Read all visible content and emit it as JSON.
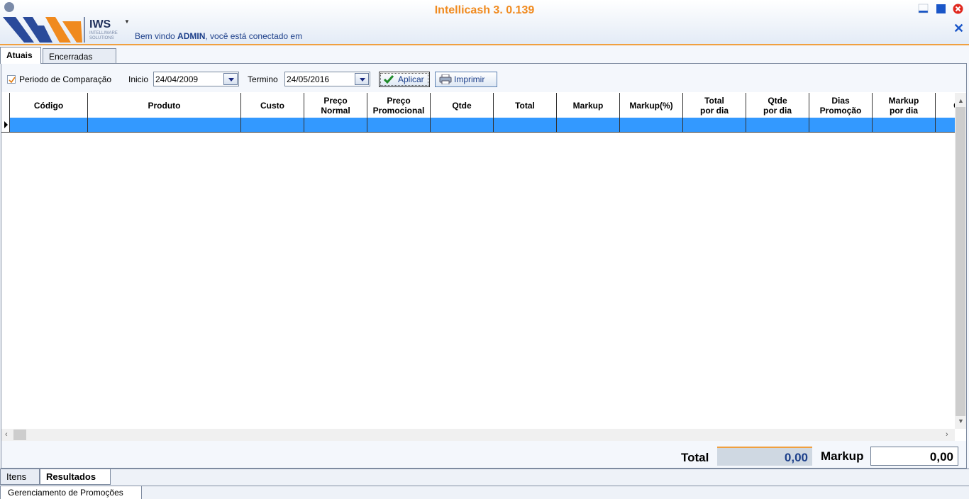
{
  "app": {
    "title": "Intellicash 3. 0.139",
    "logo_text": "IWS",
    "logo_sub": "INTELLIWARE SOLUTIONS",
    "welcome_prefix": "Bem vindo ",
    "welcome_user": "ADMIN",
    "welcome_suffix": ", você está conectado em"
  },
  "tabs_top": [
    {
      "label": "Atuais",
      "active": true
    },
    {
      "label": "Encerradas",
      "active": false
    }
  ],
  "toolbar": {
    "periodo_label": "Periodo de Comparação",
    "periodo_checked": true,
    "inicio_label": "Inicio",
    "inicio_value": "24/04/2009",
    "termino_label": "Termino",
    "termino_value": "24/05/2016",
    "aplicar_label": "Aplicar",
    "imprimir_label": "Imprimir"
  },
  "grid": {
    "columns": [
      "Código",
      "Produto",
      "Custo",
      "Preço\nNormal",
      "Preço\nPromocional",
      "Qtde",
      "Total",
      "Markup",
      "Markup(%)",
      "Total\npor dia",
      "Qtde\npor dia",
      "Dias\nPromoção",
      "Markup\npor dia",
      "C"
    ]
  },
  "totals": {
    "total_label": "Total",
    "total_value": "0,00",
    "markup_label": "Markup",
    "markup_value": "0,00"
  },
  "tabs_bottom": [
    {
      "label": "Itens",
      "active": false
    },
    {
      "label": "Resultados",
      "active": true
    }
  ],
  "status": {
    "tab_label": "Gerenciamento de Promoções"
  },
  "colors": {
    "title": "#f08a1e",
    "selection": "#3399ff",
    "accent_border": "#f0a040"
  }
}
